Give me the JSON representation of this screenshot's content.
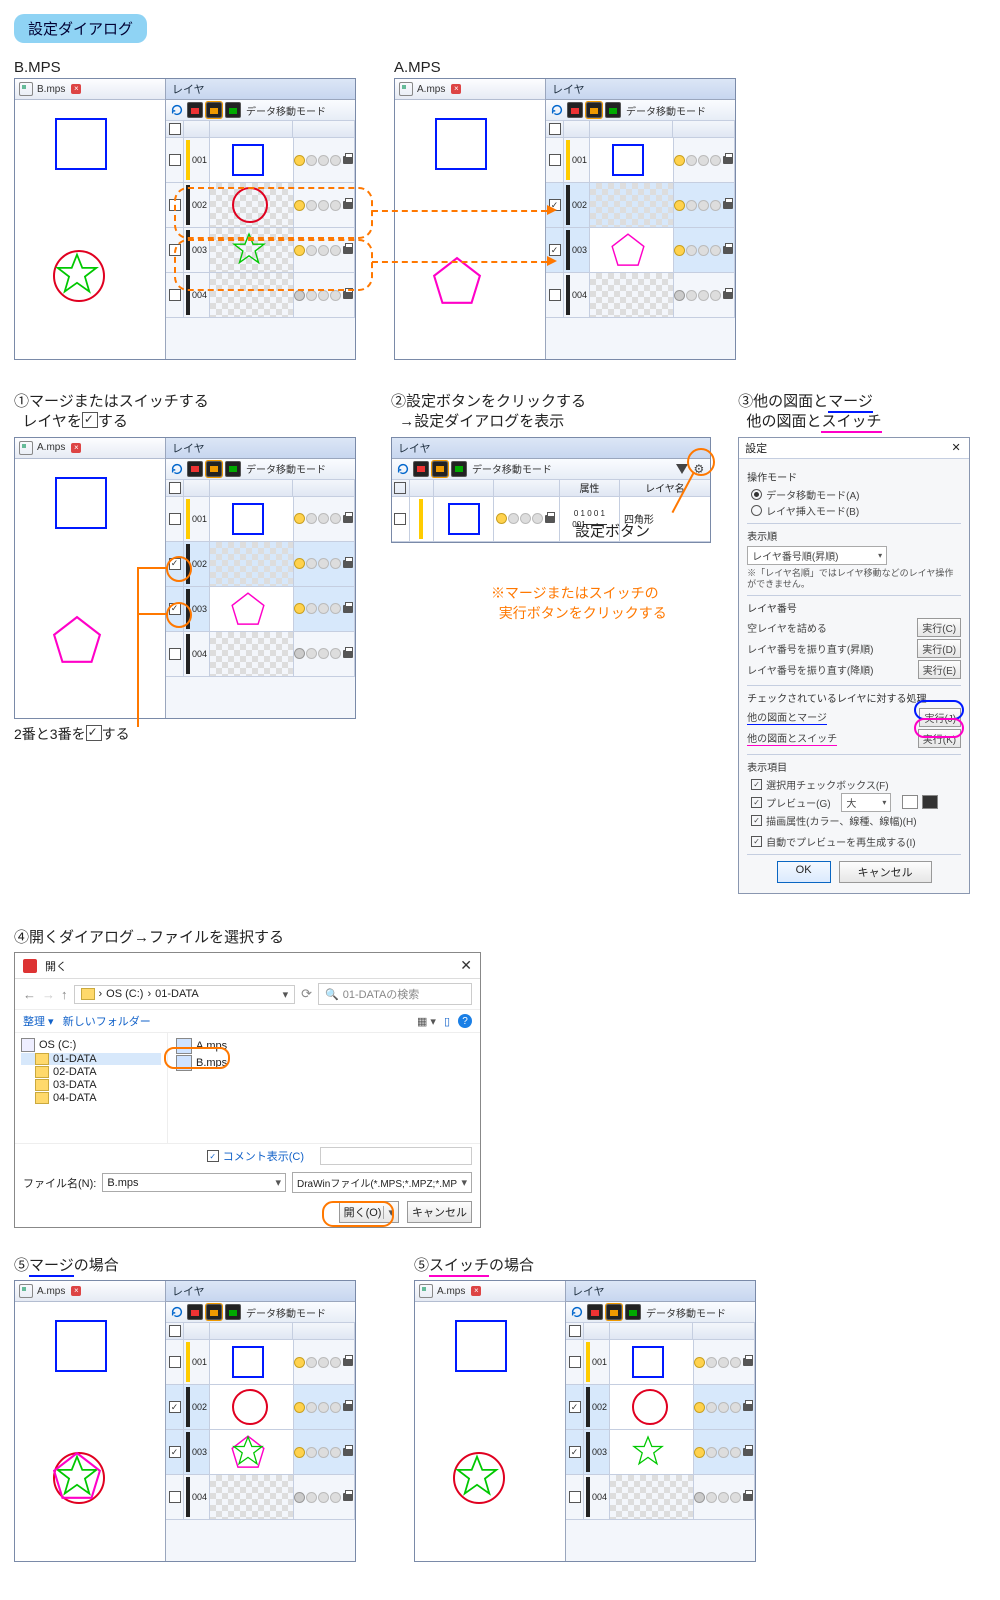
{
  "title_chip": "設定ダイアログ",
  "labels": {
    "bmps": "B.MPS",
    "amps": "A.MPS",
    "step1a": "①マージまたはスイッチする",
    "step1b": "レイヤを",
    "step1c": "する",
    "step1_note": "2番と3番を",
    "step1_note_end": "する",
    "step2a": "②設定ボタンをクリックする",
    "step2b": "→設定ダイアログを表示",
    "step2_btn": "設定ボタン",
    "step2_warn1": "※マージまたはスイッチの",
    "step2_warn2": "実行ボタンをクリックする",
    "step3a": "③他の図面と",
    "step3_merge": "マージ",
    "step3b": "他の図面と",
    "step3_switch": "スイッチ",
    "step4": "④開くダイアログ→ファイルを選択する",
    "step5m_a": "⑤",
    "step5m_b": "マージ",
    "step5m_c": "の場合",
    "step5s_a": "⑤",
    "step5s_b": "スイッチ",
    "step5s_c": "の場合"
  },
  "panel": {
    "title": "レイヤ",
    "mode": "データ移動モード",
    "col_attr": "属性",
    "col_name": "レイヤ名"
  },
  "tabs": {
    "bmps": "B.mps",
    "amps": "A.mps"
  },
  "rows": {
    "n1": "001",
    "n2": "002",
    "n3": "003",
    "n4": "004"
  },
  "attrwide": {
    "code": "0 1 0 0 1",
    "num": "001",
    "name": "四角形"
  },
  "dlg": {
    "title": "設定",
    "g_mode": "操作モード",
    "mode_a": "データ移動モード(A)",
    "mode_b": "レイヤ挿入モード(B)",
    "g_sort": "表示順",
    "sort_sel": "レイヤ番号順(昇順)",
    "sort_note": "※「レイヤ名順」ではレイヤ移動などのレイヤ操作ができません。",
    "g_num": "レイヤ番号",
    "num1": "空レイヤを詰める",
    "num1b": "実行(C)",
    "num2": "レイヤ番号を振り直す(昇順)",
    "num2b": "実行(D)",
    "num3": "レイヤ番号を振り直す(降順)",
    "num3b": "実行(E)",
    "g_chk": "チェックされているレイヤに対する処理",
    "merge": "他の図面とマージ",
    "mergeb": "実行(J)",
    "switch": "他の図面とスイッチ",
    "switchb": "実行(K)",
    "g_disp": "表示項目",
    "d1": "選択用チェックボックス(F)",
    "d2": "プレビュー(G)",
    "d2_sel": "大",
    "d3": "描画属性(カラー、線種、線幅)(H)",
    "d4": "自動でプレビューを再生成する(I)",
    "ok": "OK",
    "cancel": "キャンセル"
  },
  "odlg": {
    "title": "開く",
    "path1": "OS (C:)",
    "path2": "01-DATA",
    "srch_ph": "01-DATAの検索",
    "org": "整理",
    "newf": "新しいフォルダー",
    "drive": "OS (C:)",
    "d1": "01-DATA",
    "d2": "02-DATA",
    "d3": "03-DATA",
    "d4": "04-DATA",
    "fA": "A.mps",
    "fB": "B.mps",
    "comment": "コメント表示(C)",
    "fn_lbl": "ファイル名(N):",
    "fn_val": "B.mps",
    "filter": "DraWinファイル(*.MPS;*.MPZ;*.MP",
    "open": "開く(O)",
    "cancel": "キャンセル"
  }
}
